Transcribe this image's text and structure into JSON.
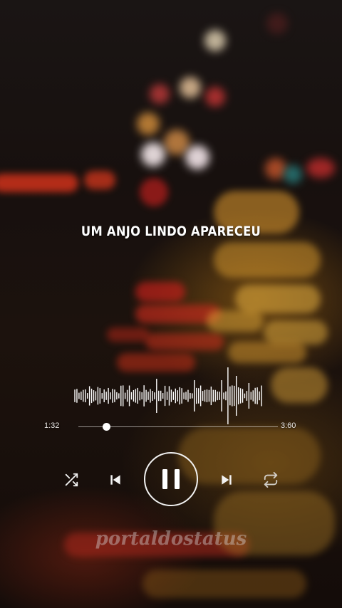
{
  "lyric": "UM ANJO LINDO APARECEU",
  "player": {
    "elapsed": "1:32",
    "total": "3:60",
    "progress_fraction": 0.14,
    "state": "playing"
  },
  "controls": {
    "shuffle_icon": "shuffle-icon",
    "previous_icon": "skip-previous-icon",
    "pause_icon": "pause-icon",
    "next_icon": "skip-next-icon",
    "repeat_icon": "repeat-icon"
  },
  "watermark": "portaldostatus",
  "colors": {
    "foreground": "#ffffff",
    "background": "#140d0b"
  }
}
